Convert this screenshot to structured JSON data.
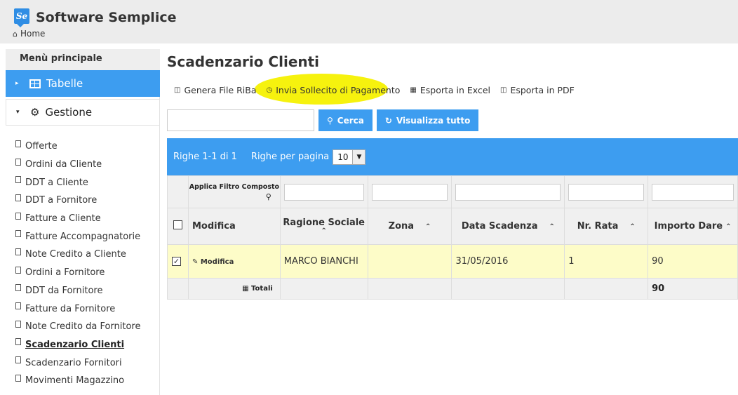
{
  "header": {
    "logo_text": "Se",
    "app_title": "Software Semplice",
    "breadcrumb": "Home"
  },
  "sidebar": {
    "title": "Menù principale",
    "groups": [
      {
        "label": "Tabelle",
        "expanded": false
      },
      {
        "label": "Gestione",
        "expanded": true
      }
    ],
    "items": [
      "Offerte",
      "Ordini da Cliente",
      "DDT a Cliente",
      "DDT a Fornitore",
      "Fatture a Cliente",
      "Fatture Accompagnatorie",
      "Note Credito a Cliente",
      "Ordini a Fornitore",
      "DDT da Fornitore",
      "Fatture da Fornitore",
      "Note Credito da Fornitore",
      "Scadenzario Clienti",
      "Scadenzario Fornitori",
      "Movimenti Magazzino"
    ],
    "active_item": "Scadenzario Clienti"
  },
  "main": {
    "title": "Scadenzario Clienti",
    "toolbar": {
      "genera_riba": "Genera File RiBa",
      "invia_sollecito": "Invia Sollecito di Pagamento",
      "esporta_excel": "Esporta in Excel",
      "esporta_pdf": "Esporta in PDF"
    },
    "search": {
      "value": "",
      "cerca": "Cerca",
      "visualizza_tutto": "Visualizza tutto"
    },
    "pager": {
      "rows_info": "Righe 1-1 di 1",
      "per_page_label": "Righe per pagina",
      "per_page_value": "10"
    },
    "table": {
      "filter_label": "Applica Filtro Composto",
      "columns": [
        "Modifica",
        "Ragione Sociale",
        "Zona",
        "Data Scadenza",
        "Nr. Rata",
        "Importo Dare"
      ],
      "rows": [
        {
          "modifica": "Modifica",
          "ragione_sociale": "MARCO BIANCHI",
          "zona": "",
          "data_scadenza": "31/05/2016",
          "nr_rata": "1",
          "importo_dare": "90"
        }
      ],
      "totals_label": "Totali",
      "total_importo": "90"
    }
  },
  "colors": {
    "accent": "#3d9df0",
    "highlight": "#f6f20e",
    "selected_row": "#fdfcc8"
  }
}
